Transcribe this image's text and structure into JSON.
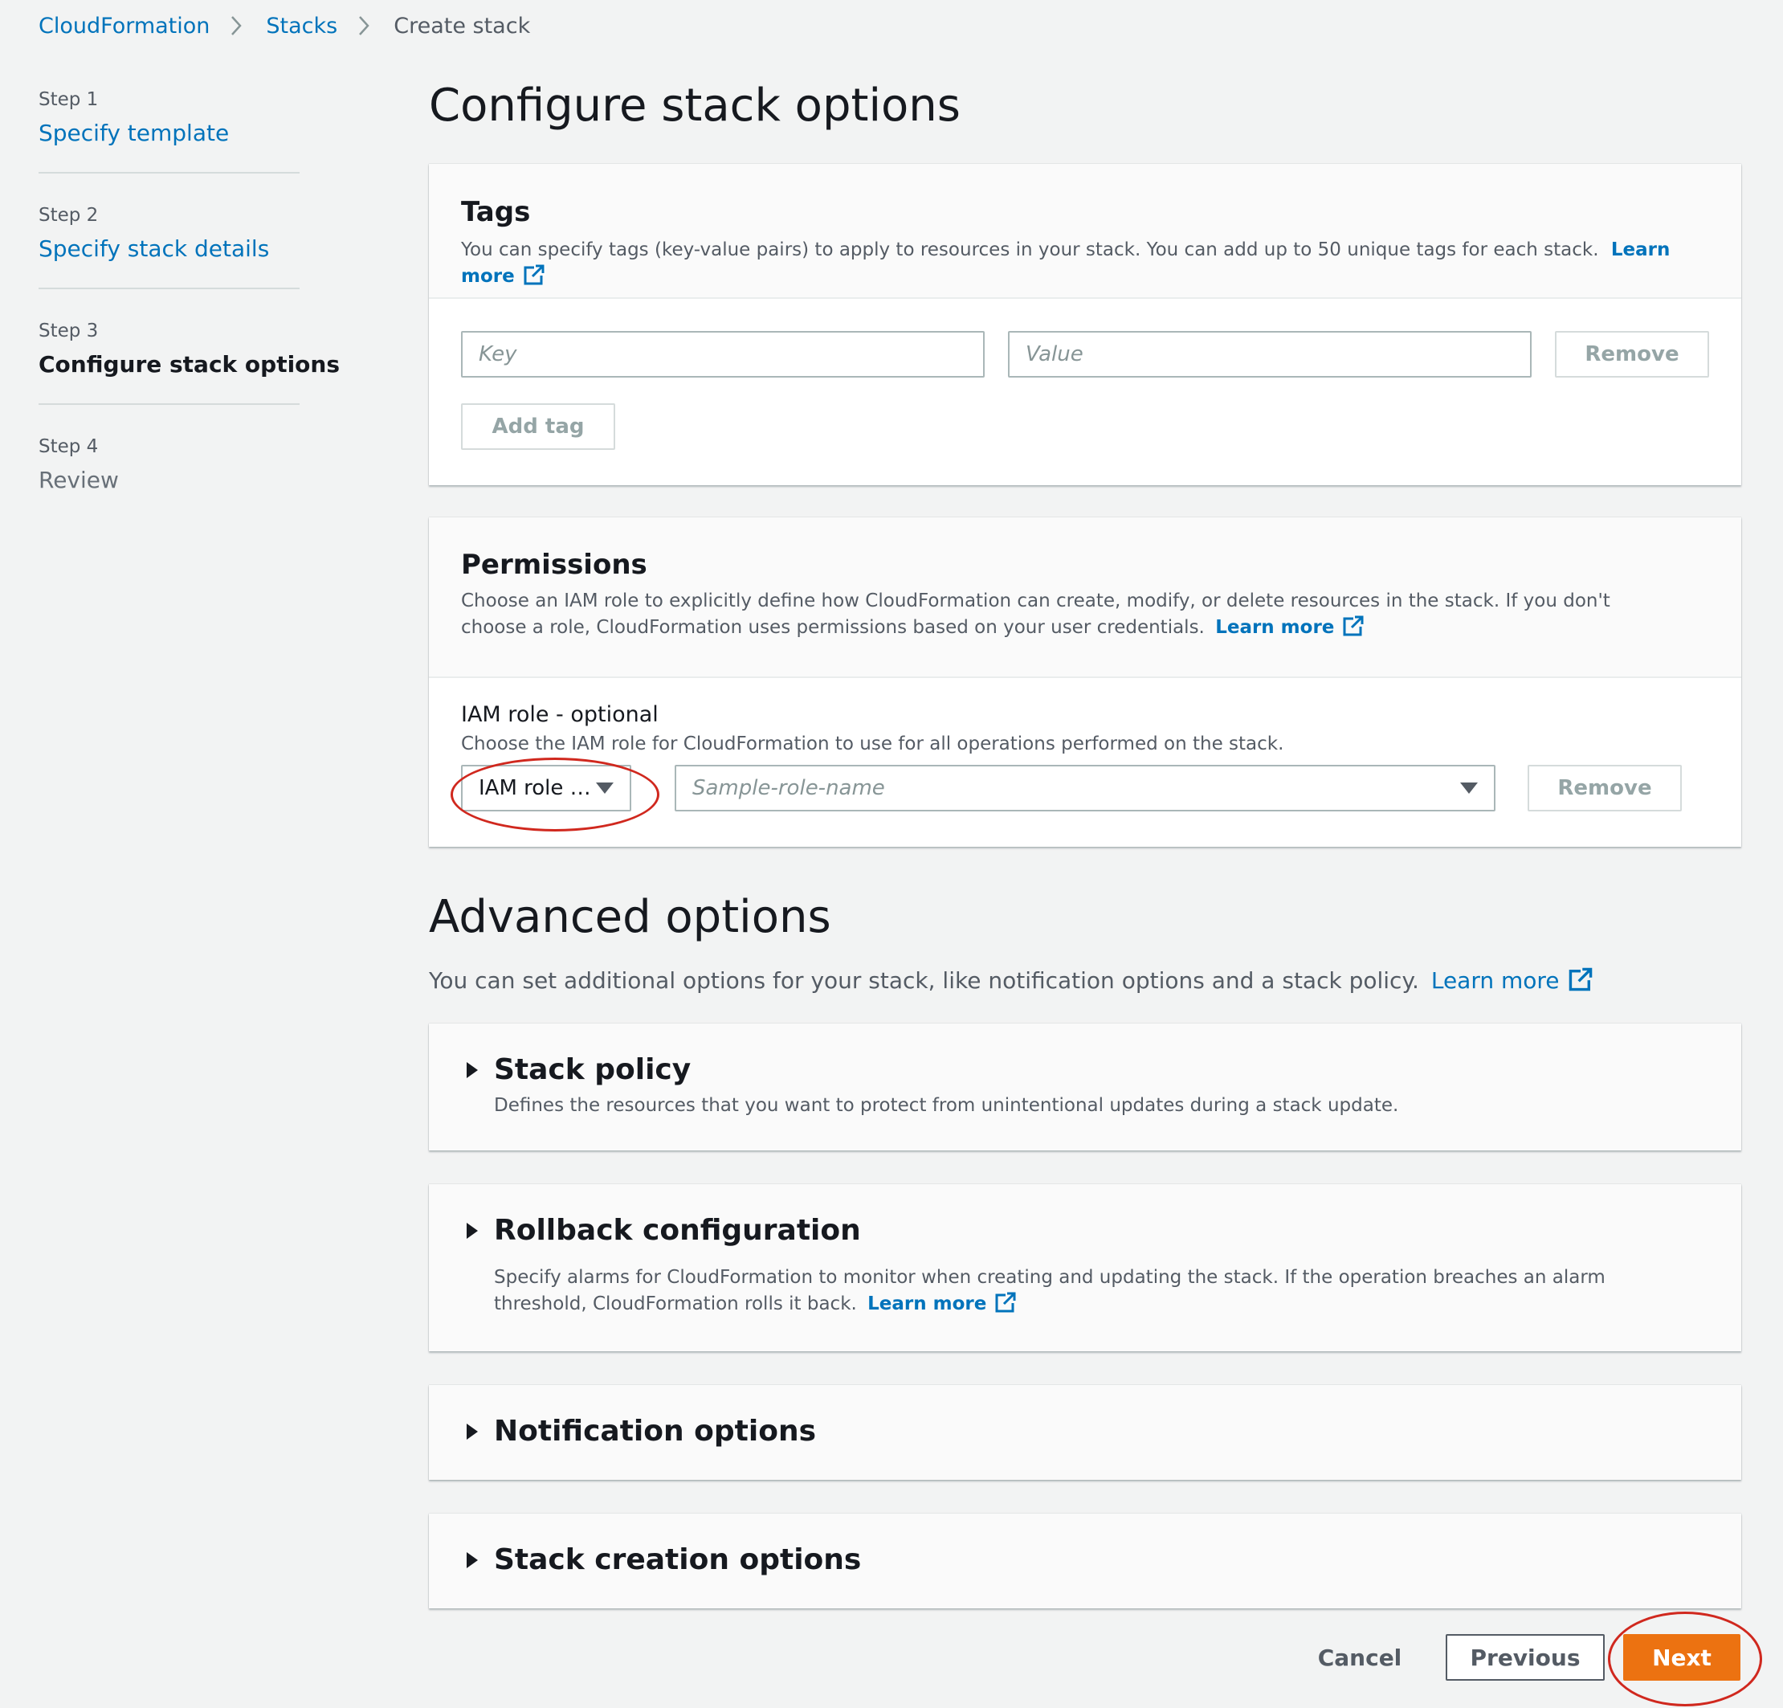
{
  "breadcrumb": {
    "items": [
      "CloudFormation",
      "Stacks"
    ],
    "current": "Create stack"
  },
  "steps": [
    {
      "number": "Step 1",
      "title": "Specify template",
      "state": "link"
    },
    {
      "number": "Step 2",
      "title": "Specify stack details",
      "state": "link"
    },
    {
      "number": "Step 3",
      "title": "Configure stack options",
      "state": "current"
    },
    {
      "number": "Step 4",
      "title": "Review",
      "state": "disabled"
    }
  ],
  "page_title": "Configure stack options",
  "tags": {
    "title": "Tags",
    "description": "You can specify tags (key-value pairs) to apply to resources in your stack. You can add up to 50 unique tags for each stack.",
    "learn_more": "Learn more",
    "key_placeholder": "Key",
    "value_placeholder": "Value",
    "remove_label": "Remove",
    "add_tag_label": "Add tag"
  },
  "permissions": {
    "title": "Permissions",
    "description": "Choose an IAM role to explicitly define how CloudFormation can create, modify, or delete resources in the stack. If you don't choose a role, CloudFormation uses permissions based on your user credentials.",
    "learn_more": "Learn more",
    "iam_label": "IAM role - optional",
    "iam_description": "Choose the IAM role for CloudFormation to use for all operations performed on the stack.",
    "role_type_value": "IAM role …",
    "role_name_placeholder": "Sample-role-name",
    "remove_label": "Remove"
  },
  "advanced": {
    "title": "Advanced options",
    "description": "You can set additional options for your stack, like notification options and a stack policy.",
    "learn_more": "Learn more",
    "sections": [
      {
        "title": "Stack policy",
        "description": "Defines the resources that you want to protect from unintentional updates during a stack update."
      },
      {
        "title": "Rollback configuration",
        "description": "Specify alarms for CloudFormation to monitor when creating and updating the stack. If the operation breaches an alarm threshold, CloudFormation rolls it back.",
        "learn_more": "Learn more"
      },
      {
        "title": "Notification options"
      },
      {
        "title": "Stack creation options"
      }
    ]
  },
  "footer": {
    "cancel": "Cancel",
    "previous": "Previous",
    "next": "Next"
  },
  "colors": {
    "link": "#0073bb",
    "primary": "#ec7211",
    "annotation": "#d0281e",
    "background": "#f2f3f3"
  },
  "icons": [
    "chevron-right-icon",
    "external-link-icon",
    "caret-down-icon",
    "expand-triangle-icon"
  ]
}
